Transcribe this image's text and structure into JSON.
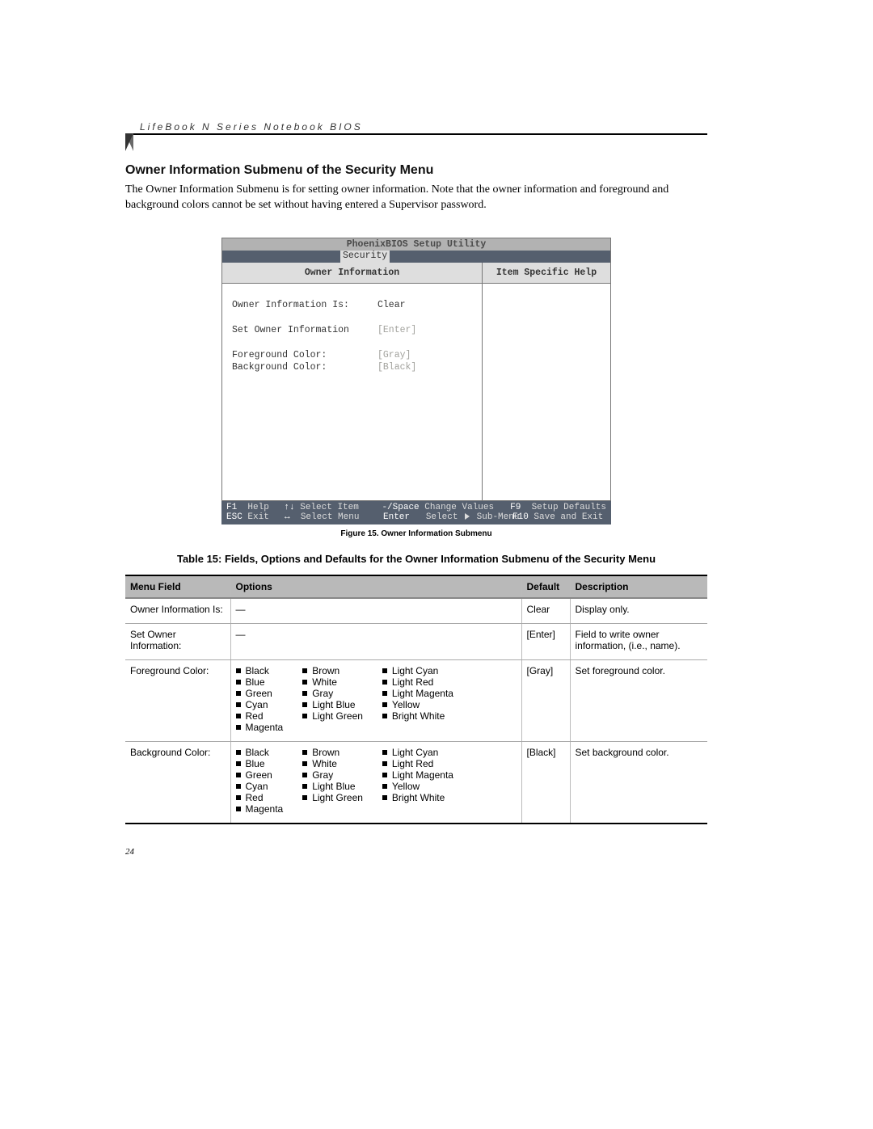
{
  "running_header": "LifeBook N Series Notebook BIOS",
  "section_title": "Owner Information Submenu of the Security Menu",
  "intro": "The Owner Information Submenu is for setting owner information. Note that the owner information and foreground and background colors cannot be set without having entered a Supervisor password.",
  "page_number": "24",
  "bios": {
    "title": "PhoenixBIOS Setup Utility",
    "active_tab": "Security",
    "left_panel_title": "Owner Information",
    "right_panel_title": "Item Specific Help",
    "fields": [
      {
        "label": "Owner Information Is:",
        "value": "Clear",
        "dim": false,
        "gap_after": true
      },
      {
        "label": "Set Owner Information",
        "value": "[Enter]",
        "dim": true,
        "gap_after": true
      },
      {
        "label": "Foreground Color:",
        "value": "[Gray]",
        "dim": true,
        "gap_after": false
      },
      {
        "label": "Background Color:",
        "value": "[Black]",
        "dim": true,
        "gap_after": false
      }
    ],
    "footer": {
      "row1": {
        "c1_key": "F1",
        "c1_text": "Help",
        "c2_key": "↑↓",
        "c2_text": "Select Item",
        "c3_key": "-/Space",
        "c3_text": "Change Values",
        "c4_key": "F9",
        "c4_text": "Setup Defaults"
      },
      "row2": {
        "c1_key": "ESC",
        "c1_text": "Exit",
        "c2_key": "↔",
        "c2_text": "Select Menu",
        "c3_key": "Enter",
        "c3_text_prefix": "Select",
        "c3_text_suffix": "Sub-Menu",
        "c4_key": "F10",
        "c4_text": "Save and Exit"
      }
    }
  },
  "figure_caption": "Figure 15.  Owner Information Submenu",
  "table_caption": "Table 15: Fields, Options and Defaults for the Owner Information Submenu of the Security Menu",
  "table": {
    "headers": [
      "Menu Field",
      "Options",
      "Default",
      "Description"
    ],
    "rows": [
      {
        "field": "Owner Information Is:",
        "options_dash": "—",
        "default": "Clear",
        "description": "Display only."
      },
      {
        "field": "Set Owner Information:",
        "options_dash": "—",
        "default": "[Enter]",
        "description": "Field to write owner information, (i.e., name)."
      },
      {
        "field": "Foreground Color:",
        "options": {
          "col1": [
            "Black",
            "Blue",
            "Green",
            "Cyan",
            "Red",
            "Magenta"
          ],
          "col2": [
            "Brown",
            "White",
            "Gray",
            "Light Blue",
            "Light Green"
          ],
          "col3": [
            "Light Cyan",
            "Light Red",
            "Light Magenta",
            "Yellow",
            "Bright White"
          ]
        },
        "default": "[Gray]",
        "description": "Set foreground color."
      },
      {
        "field": "Background Color:",
        "options": {
          "col1": [
            "Black",
            "Blue",
            "Green",
            "Cyan",
            "Red",
            "Magenta"
          ],
          "col2": [
            "Brown",
            "White",
            "Gray",
            "Light Blue",
            "Light Green"
          ],
          "col3": [
            "Light Cyan",
            "Light Red",
            "Light Magenta",
            "Yellow",
            "Bright White"
          ]
        },
        "default": "[Black]",
        "description": "Set background color."
      }
    ]
  }
}
